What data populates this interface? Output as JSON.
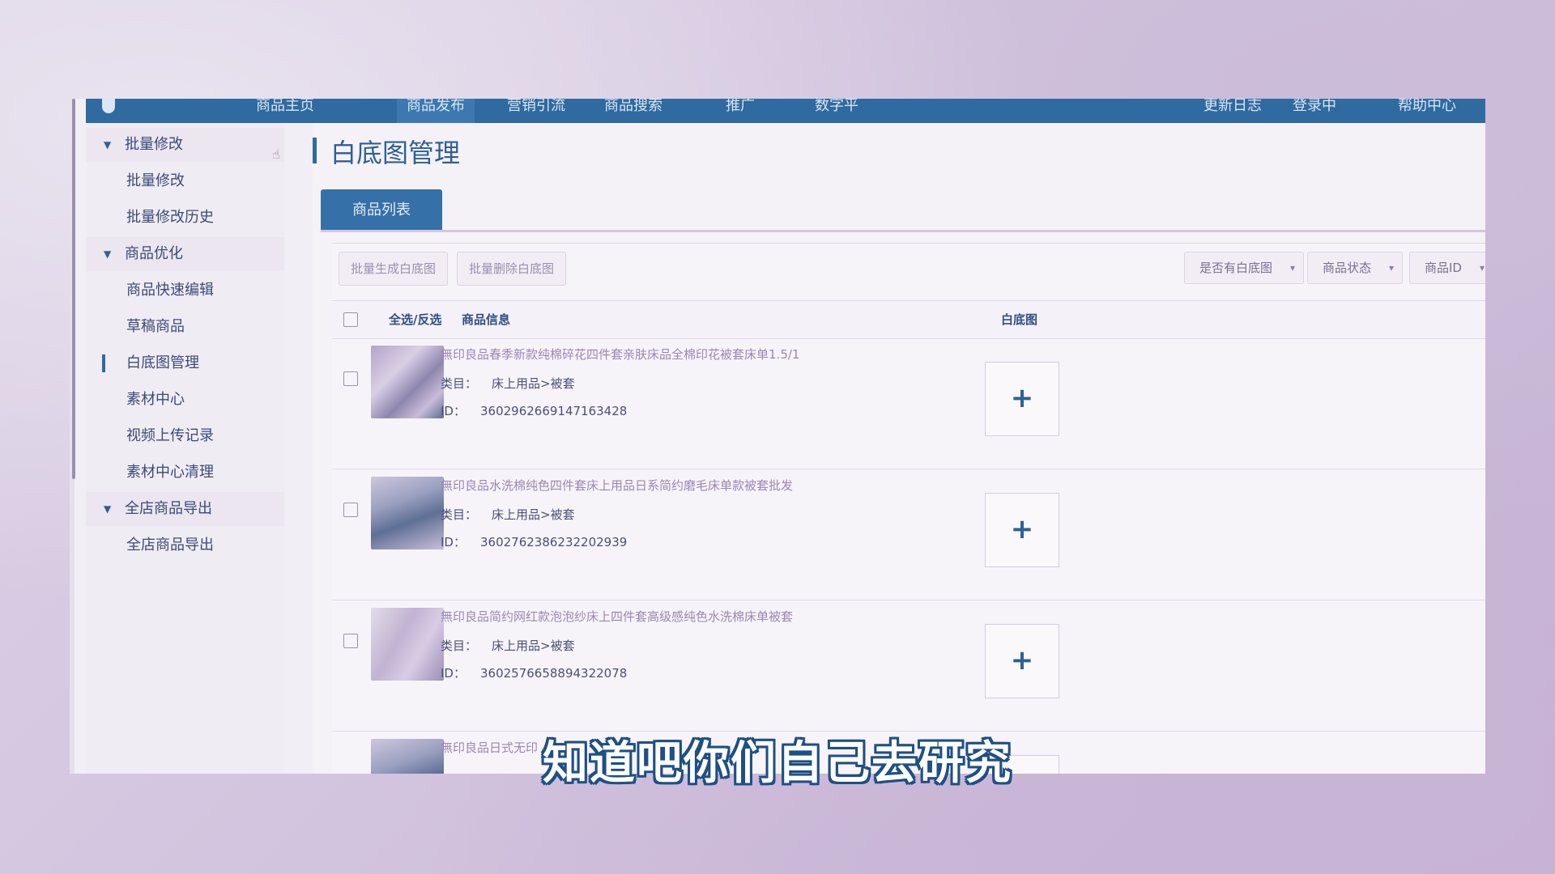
{
  "topnav": {
    "items": [
      "商品主页",
      "商品发布",
      "营销引流",
      "商品搜索",
      "推广",
      "数字平"
    ],
    "active_index": 1,
    "right_items": [
      "更新日志",
      "登录中",
      "帮助中心"
    ]
  },
  "sidebar": {
    "items": [
      {
        "label": "批量修改",
        "type": "group"
      },
      {
        "label": "批量修改",
        "type": "child"
      },
      {
        "label": "批量修改历史",
        "type": "child"
      },
      {
        "label": "商品优化",
        "type": "group"
      },
      {
        "label": "商品快速编辑",
        "type": "child"
      },
      {
        "label": "草稿商品",
        "type": "child"
      },
      {
        "label": "白底图管理",
        "type": "child",
        "active": true
      },
      {
        "label": "素材中心",
        "type": "child"
      },
      {
        "label": "视频上传记录",
        "type": "child"
      },
      {
        "label": "素材中心清理",
        "type": "child"
      },
      {
        "label": "全店商品导出",
        "type": "group"
      },
      {
        "label": "全店商品导出",
        "type": "child"
      }
    ]
  },
  "page": {
    "title": "白底图管理",
    "tab": "商品列表"
  },
  "toolbar": {
    "batch_generate": "批量生成白底图",
    "batch_delete": "批量删除白底图",
    "filters": [
      "是否有白底图",
      "商品状态",
      "商品ID"
    ]
  },
  "table": {
    "headers": {
      "select_all": "全选/反选",
      "product_info": "商品信息",
      "white_bg": "白底图"
    },
    "category_label": "类目：",
    "id_label": "ID：",
    "rows": [
      {
        "title": "無印良品春季新款纯棉碎花四件套亲肤床品全棉印花被套床单1.5/1",
        "category": "床上用品>被套",
        "id": "3602962669147163428"
      },
      {
        "title": "無印良品水洗棉纯色四件套床上用品日系简约磨毛床单款被套批发",
        "category": "床上用品>被套",
        "id": "3602762386232202939"
      },
      {
        "title": "無印良品简约网红款泡泡纱床上四件套高级感纯色水洗棉床单被套",
        "category": "床上用品>被套",
        "id": "3602576658894322078"
      },
      {
        "title": "無印良品日式无印",
        "category": "",
        "id": ""
      }
    ],
    "add_symbol": "+"
  },
  "subtitle": "知道吧你们自己去研究"
}
